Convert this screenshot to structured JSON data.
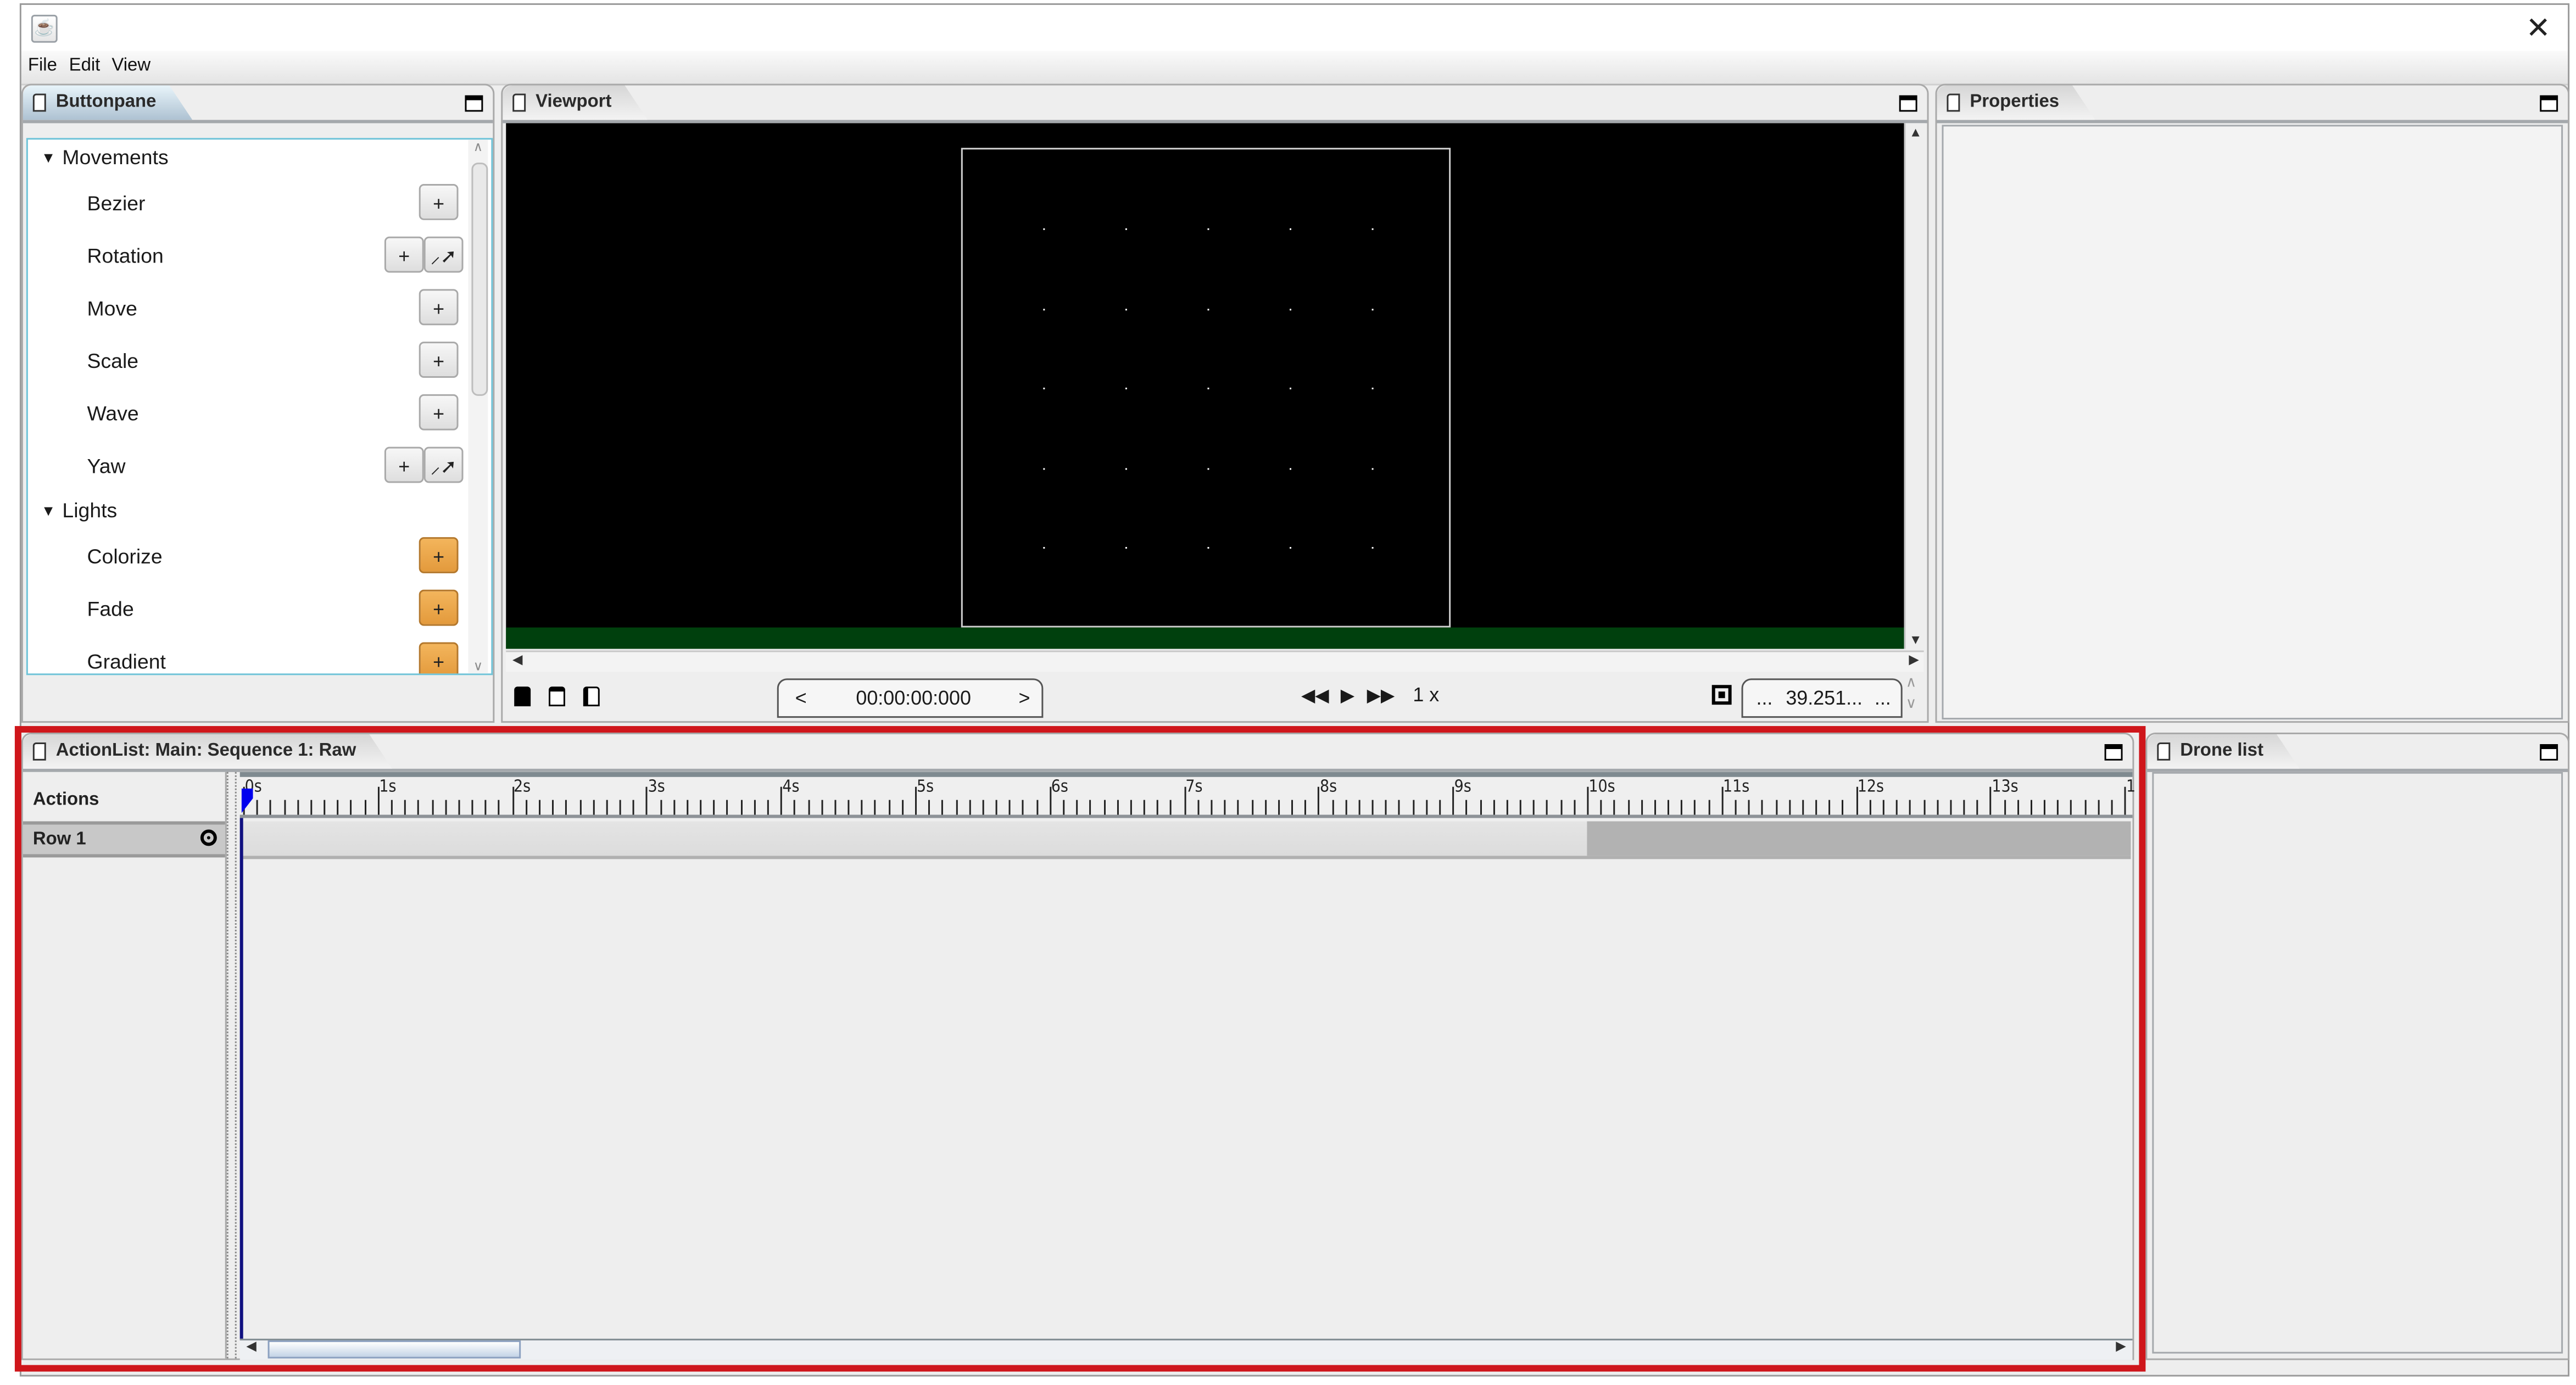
{
  "window": {
    "title": "",
    "app_icon": "java-icon",
    "close_icon": "close-icon"
  },
  "menubar": {
    "items": [
      "File",
      "Edit",
      "View"
    ]
  },
  "buttonpane": {
    "title": "Buttonpane",
    "groups": [
      {
        "label": "Movements",
        "expanded": true,
        "items": [
          {
            "label": "Bezier",
            "buttons": [
              "+"
            ]
          },
          {
            "label": "Rotation",
            "buttons": [
              "+",
              "pick-tool"
            ]
          },
          {
            "label": "Move",
            "buttons": [
              "+"
            ]
          },
          {
            "label": "Scale",
            "buttons": [
              "+"
            ]
          },
          {
            "label": "Wave",
            "buttons": [
              "+"
            ]
          },
          {
            "label": "Yaw",
            "buttons": [
              "+",
              "pick-tool"
            ]
          }
        ]
      },
      {
        "label": "Lights",
        "expanded": true,
        "items": [
          {
            "label": "Colorize",
            "buttons": [
              "+"
            ]
          },
          {
            "label": "Fade",
            "buttons": [
              "+"
            ]
          },
          {
            "label": "Gradient",
            "buttons": [
              "+"
            ]
          }
        ]
      }
    ],
    "add_label": "+",
    "light_button_color": "#e9a44a"
  },
  "viewport": {
    "title": "Viewport",
    "background_color": "#000000",
    "ground_color": "#00400d",
    "drone_grid": {
      "rows": 5,
      "cols": 5
    },
    "time": "00:00:00:000",
    "prev_label": "<",
    "next_label": ">",
    "speed": "1 x",
    "zoom_value": "39.251...",
    "zoom_left": "...",
    "zoom_right": "..."
  },
  "properties": {
    "title": "Properties"
  },
  "actionlist": {
    "title": "ActionList: Main: Sequence 1: Raw",
    "actions_header": "Actions",
    "rows": [
      {
        "label": "Row 1",
        "visible": true,
        "block_start_s": 10,
        "block_end_s": 14
      }
    ],
    "timeline": {
      "tick_labels": [
        "0s",
        "1s",
        "2s",
        "3s",
        "4s",
        "5s",
        "6s",
        "7s",
        "8s",
        "9s",
        "10s",
        "11s",
        "12s",
        "13s",
        "1"
      ],
      "minor_ticks_per_second": 10,
      "visible_seconds": 14,
      "playhead_s": 0
    },
    "highlight_color": "#cf161b"
  },
  "dronelist": {
    "title": "Drone list"
  }
}
